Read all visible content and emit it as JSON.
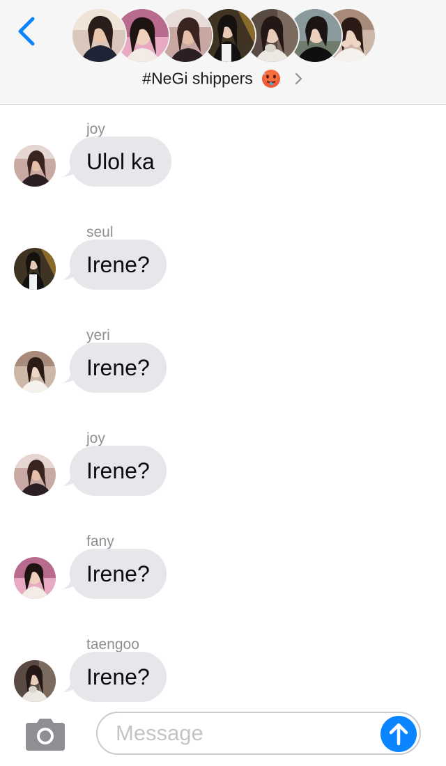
{
  "header": {
    "back_icon": "chevron-left-icon",
    "group_title": "#NeGi shippers",
    "title_emoji": "hot-face-emoji",
    "disclosure_icon": "chevron-right-icon",
    "accent_color": "#0a84ff",
    "member_avatars": [
      "avatar-1",
      "avatar-2",
      "avatar-3",
      "avatar-4",
      "avatar-5",
      "avatar-6",
      "avatar-7"
    ]
  },
  "messages": [
    {
      "sender": "joy",
      "text": "Ulol ka"
    },
    {
      "sender": "seul",
      "text": "Irene?"
    },
    {
      "sender": "yeri",
      "text": "Irene?"
    },
    {
      "sender": "joy",
      "text": "Irene?"
    },
    {
      "sender": "fany",
      "text": "Irene?"
    },
    {
      "sender": "taengoo",
      "text": "Irene?"
    }
  ],
  "composer": {
    "camera_icon": "camera-icon",
    "placeholder": "Message",
    "value": "",
    "send_icon": "arrow-up-icon",
    "send_color": "#0a84ff"
  },
  "colors": {
    "header_bg": "#f6f6f7",
    "bubble_bg": "#e6e6eb",
    "sender_name": "#8e8e93"
  }
}
